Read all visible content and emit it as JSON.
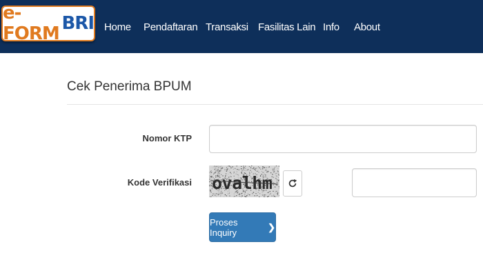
{
  "brand": {
    "part1": "e-FORM",
    "part2": "BRI"
  },
  "nav": {
    "items": [
      "Home",
      "Pendaftaran",
      "Transaksi",
      "Fasilitas Lain",
      "Info",
      "About"
    ]
  },
  "page": {
    "title": "Cek Penerima BPUM"
  },
  "form": {
    "ktp_label": "Nomor KTP",
    "ktp_value": "",
    "verif_label": "Kode Verifikasi",
    "captcha_text": "ovalhm",
    "verif_value": "",
    "submit_label": "Proses Inquiry",
    "submit_icon": "chevron-right-icon",
    "refresh_icon": "refresh-icon"
  },
  "colors": {
    "navbar": "#0e2f5a",
    "brand_orange": "#e07a1f",
    "brand_blue": "#1b57a8",
    "button": "#337ab7"
  }
}
